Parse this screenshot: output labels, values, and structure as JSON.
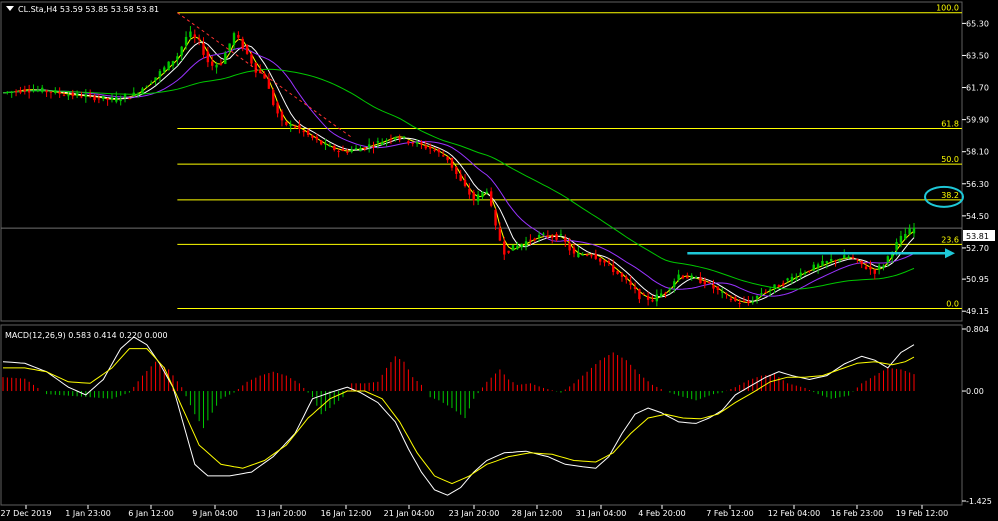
{
  "header": {
    "symbol_info": "CL.Sta,H4  53.59 53.85 53.58 53.81",
    "macd_info": "MACD(12,26,9) 0.583 0.414 0.220 0.000"
  },
  "price_badge": "53.81",
  "colors": {
    "background": "#000000",
    "grid": "#404040",
    "bull": "#00c800",
    "bear": "#ff0000",
    "fib": "#ffff00",
    "ma_fast": "#ffff00",
    "ma_mid": "#ffffff",
    "ma_slow1": "#9933ff",
    "ma_slow2": "#00c800",
    "annotation": "#1ec8d8",
    "trendline": "#ff3030"
  },
  "chart_data": [
    {
      "type": "candlestick",
      "panel": "price",
      "x_tick_labels": [
        "27 Dec 2019",
        "1 Jan 23:00",
        "6 Jan 12:00",
        "9 Jan 04:00",
        "13 Jan 20:00",
        "16 Jan 12:00",
        "21 Jan 04:00",
        "23 Jan 20:00",
        "28 Jan 12:00",
        "31 Jan 04:00",
        "4 Feb 20:00",
        "7 Feb 12:00",
        "12 Feb 04:00",
        "16 Feb 23:00",
        "19 Feb 12:00"
      ],
      "y_tick_labels": [
        "65.30",
        "63.50",
        "61.70",
        "59.90",
        "58.10",
        "56.30",
        "54.50",
        "52.70",
        "50.95",
        "49.15"
      ],
      "ylim": [
        48.6,
        66.5
      ],
      "fib_levels": [
        {
          "label": "100.0",
          "value": 65.9
        },
        {
          "label": "61.8",
          "value": 59.4
        },
        {
          "label": "50.0",
          "value": 57.4
        },
        {
          "label": "38.2",
          "value": 55.4
        },
        {
          "label": "23.6",
          "value": 52.9
        },
        {
          "label": "0.0",
          "value": 49.3
        }
      ],
      "last_price": 53.81,
      "close_path": [
        [
          0,
          61.4
        ],
        [
          10,
          61.6
        ],
        [
          20,
          61.5
        ],
        [
          30,
          61.3
        ],
        [
          40,
          61.2
        ],
        [
          50,
          61.0
        ],
        [
          60,
          61.3
        ],
        [
          70,
          62.3
        ],
        [
          80,
          63.5
        ],
        [
          85,
          64.8
        ],
        [
          90,
          64.2
        ],
        [
          95,
          62.9
        ],
        [
          100,
          63.1
        ],
        [
          106,
          64.7
        ],
        [
          110,
          64.0
        ],
        [
          116,
          62.7
        ],
        [
          120,
          62.3
        ],
        [
          124,
          60.8
        ],
        [
          128,
          59.7
        ],
        [
          134,
          59.5
        ],
        [
          140,
          59.0
        ],
        [
          148,
          58.4
        ],
        [
          156,
          58.1
        ],
        [
          164,
          58.3
        ],
        [
          172,
          58.6
        ],
        [
          180,
          59.0
        ],
        [
          188,
          58.6
        ],
        [
          196,
          58.3
        ],
        [
          204,
          57.7
        ],
        [
          210,
          56.4
        ],
        [
          216,
          55.4
        ],
        [
          222,
          56.0
        ],
        [
          226,
          53.8
        ],
        [
          230,
          52.5
        ],
        [
          236,
          52.8
        ],
        [
          244,
          53.3
        ],
        [
          250,
          53.4
        ],
        [
          256,
          53.3
        ],
        [
          262,
          52.3
        ],
        [
          270,
          52.4
        ],
        [
          278,
          51.7
        ],
        [
          286,
          50.8
        ],
        [
          292,
          50.0
        ],
        [
          298,
          49.8
        ],
        [
          304,
          50.3
        ],
        [
          310,
          51.2
        ],
        [
          316,
          51.0
        ],
        [
          322,
          50.8
        ],
        [
          330,
          50.1
        ],
        [
          336,
          49.7
        ],
        [
          342,
          49.6
        ],
        [
          348,
          50.2
        ],
        [
          354,
          50.5
        ],
        [
          360,
          50.9
        ],
        [
          366,
          51.3
        ],
        [
          372,
          51.6
        ],
        [
          380,
          52.0
        ],
        [
          388,
          52.2
        ],
        [
          396,
          51.6
        ],
        [
          400,
          51.4
        ],
        [
          404,
          51.8
        ],
        [
          408,
          52.6
        ],
        [
          413,
          53.4
        ],
        [
          418,
          53.8
        ]
      ],
      "indicators": [
        "MA fast (yellow)",
        "MA mid (white)",
        "MA slow (purple)",
        "MA long (green)"
      ],
      "annotations": [
        "circle around 38.2",
        "horizontal arrow pointing right",
        "dashed red trendline from 100.0"
      ]
    },
    {
      "type": "macd",
      "panel": "indicator",
      "params": [
        12,
        26,
        9
      ],
      "values": {
        "main": 0.583,
        "signal": 0.414,
        "histogram": 0.22
      },
      "y_tick_labels": [
        "0.804",
        "0.00",
        "-1.425"
      ],
      "ylim": [
        -1.425,
        0.804
      ],
      "histogram": [
        [
          0,
          0.18
        ],
        [
          10,
          0.16
        ],
        [
          20,
          -0.04
        ],
        [
          30,
          -0.06
        ],
        [
          40,
          -0.08
        ],
        [
          50,
          -0.1
        ],
        [
          58,
          -0.02
        ],
        [
          64,
          0.2
        ],
        [
          70,
          0.38
        ],
        [
          76,
          0.28
        ],
        [
          82,
          0.05
        ],
        [
          88,
          -0.3
        ],
        [
          92,
          -0.48
        ],
        [
          96,
          -0.28
        ],
        [
          100,
          -0.1
        ],
        [
          106,
          -0.02
        ],
        [
          112,
          0.12
        ],
        [
          118,
          0.2
        ],
        [
          124,
          0.25
        ],
        [
          130,
          0.2
        ],
        [
          136,
          0.1
        ],
        [
          142,
          -0.08
        ],
        [
          146,
          -0.3
        ],
        [
          150,
          -0.22
        ],
        [
          156,
          -0.08
        ],
        [
          160,
          0.1
        ],
        [
          166,
          0.1
        ],
        [
          172,
          0.12
        ],
        [
          176,
          0.3
        ],
        [
          180,
          0.45
        ],
        [
          184,
          0.38
        ],
        [
          188,
          0.18
        ],
        [
          192,
          0.08
        ],
        [
          196,
          -0.08
        ],
        [
          200,
          -0.12
        ],
        [
          206,
          -0.22
        ],
        [
          212,
          -0.35
        ],
        [
          216,
          -0.1
        ],
        [
          222,
          0.12
        ],
        [
          228,
          0.28
        ],
        [
          232,
          0.15
        ],
        [
          236,
          0.08
        ],
        [
          242,
          0.1
        ],
        [
          248,
          0.04
        ],
        [
          256,
          -0.02
        ],
        [
          262,
          0.1
        ],
        [
          268,
          0.25
        ],
        [
          274,
          0.4
        ],
        [
          280,
          0.5
        ],
        [
          286,
          0.4
        ],
        [
          292,
          0.22
        ],
        [
          298,
          0.08
        ],
        [
          304,
          0.0
        ],
        [
          310,
          -0.06
        ],
        [
          318,
          -0.12
        ],
        [
          326,
          -0.04
        ],
        [
          330,
          -0.02
        ],
        [
          336,
          0.05
        ],
        [
          342,
          0.14
        ],
        [
          348,
          0.2
        ],
        [
          354,
          0.22
        ],
        [
          360,
          0.1
        ],
        [
          368,
          0.04
        ],
        [
          374,
          -0.04
        ],
        [
          380,
          -0.1
        ],
        [
          388,
          -0.06
        ],
        [
          394,
          0.1
        ],
        [
          400,
          0.2
        ],
        [
          406,
          0.3
        ],
        [
          412,
          0.28
        ],
        [
          418,
          0.22
        ]
      ],
      "main_line": [
        [
          0,
          0.38
        ],
        [
          10,
          0.36
        ],
        [
          20,
          0.25
        ],
        [
          30,
          0.05
        ],
        [
          38,
          -0.05
        ],
        [
          46,
          0.15
        ],
        [
          54,
          0.55
        ],
        [
          60,
          0.7
        ],
        [
          66,
          0.6
        ],
        [
          72,
          0.35
        ],
        [
          78,
          0.05
        ],
        [
          84,
          -0.55
        ],
        [
          88,
          -0.95
        ],
        [
          94,
          -1.1
        ],
        [
          104,
          -1.1
        ],
        [
          114,
          -1.05
        ],
        [
          124,
          -0.85
        ],
        [
          134,
          -0.55
        ],
        [
          142,
          -0.1
        ],
        [
          150,
          -0.02
        ],
        [
          158,
          0.05
        ],
        [
          164,
          -0.02
        ],
        [
          172,
          -0.15
        ],
        [
          180,
          -0.4
        ],
        [
          186,
          -0.75
        ],
        [
          192,
          -1.05
        ],
        [
          198,
          -1.28
        ],
        [
          204,
          -1.35
        ],
        [
          210,
          -1.25
        ],
        [
          216,
          -1.05
        ],
        [
          222,
          -0.9
        ],
        [
          230,
          -0.8
        ],
        [
          240,
          -0.78
        ],
        [
          250,
          -0.85
        ],
        [
          258,
          -0.95
        ],
        [
          266,
          -0.98
        ],
        [
          272,
          -1.0
        ],
        [
          278,
          -0.85
        ],
        [
          284,
          -0.55
        ],
        [
          290,
          -0.3
        ],
        [
          296,
          -0.22
        ],
        [
          302,
          -0.28
        ],
        [
          310,
          -0.4
        ],
        [
          318,
          -0.42
        ],
        [
          324,
          -0.35
        ],
        [
          330,
          -0.25
        ],
        [
          336,
          -0.05
        ],
        [
          342,
          0.05
        ],
        [
          350,
          0.18
        ],
        [
          356,
          0.25
        ],
        [
          362,
          0.2
        ],
        [
          370,
          0.15
        ],
        [
          378,
          0.2
        ],
        [
          386,
          0.35
        ],
        [
          394,
          0.45
        ],
        [
          400,
          0.4
        ],
        [
          406,
          0.3
        ],
        [
          412,
          0.5
        ],
        [
          418,
          0.6
        ]
      ],
      "signal_line": [
        [
          0,
          0.3
        ],
        [
          10,
          0.3
        ],
        [
          20,
          0.25
        ],
        [
          30,
          0.12
        ],
        [
          40,
          0.1
        ],
        [
          50,
          0.3
        ],
        [
          58,
          0.55
        ],
        [
          66,
          0.55
        ],
        [
          74,
          0.3
        ],
        [
          82,
          -0.2
        ],
        [
          90,
          -0.7
        ],
        [
          100,
          -0.95
        ],
        [
          110,
          -1.0
        ],
        [
          120,
          -0.9
        ],
        [
          130,
          -0.7
        ],
        [
          140,
          -0.35
        ],
        [
          150,
          -0.1
        ],
        [
          158,
          0.0
        ],
        [
          166,
          0.0
        ],
        [
          174,
          -0.1
        ],
        [
          182,
          -0.4
        ],
        [
          190,
          -0.8
        ],
        [
          198,
          -1.1
        ],
        [
          206,
          -1.2
        ],
        [
          214,
          -1.1
        ],
        [
          222,
          -0.95
        ],
        [
          232,
          -0.85
        ],
        [
          242,
          -0.8
        ],
        [
          252,
          -0.82
        ],
        [
          262,
          -0.9
        ],
        [
          272,
          -0.92
        ],
        [
          280,
          -0.8
        ],
        [
          288,
          -0.55
        ],
        [
          296,
          -0.35
        ],
        [
          304,
          -0.3
        ],
        [
          312,
          -0.35
        ],
        [
          320,
          -0.36
        ],
        [
          328,
          -0.3
        ],
        [
          336,
          -0.15
        ],
        [
          344,
          -0.02
        ],
        [
          352,
          0.12
        ],
        [
          360,
          0.18
        ],
        [
          368,
          0.18
        ],
        [
          376,
          0.2
        ],
        [
          384,
          0.28
        ],
        [
          392,
          0.36
        ],
        [
          400,
          0.38
        ],
        [
          408,
          0.34
        ],
        [
          414,
          0.38
        ],
        [
          418,
          0.44
        ]
      ]
    }
  ]
}
